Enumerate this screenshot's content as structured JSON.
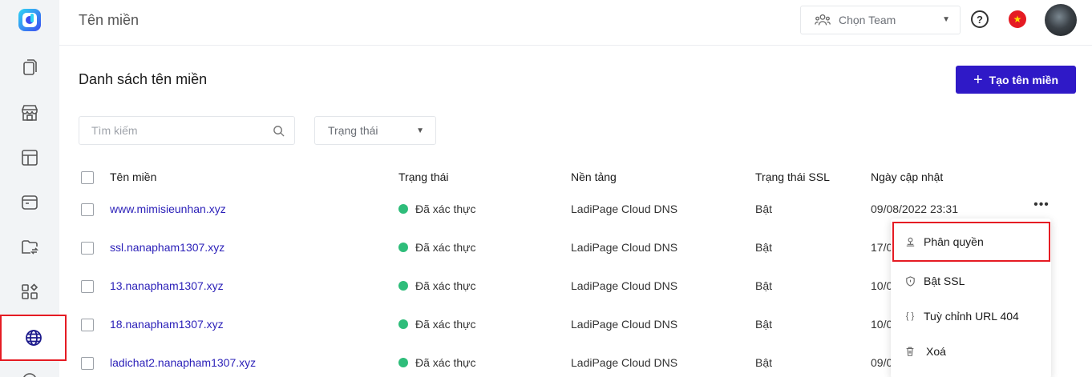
{
  "header": {
    "title": "Tên miền",
    "team_select": "Chọn Team"
  },
  "main": {
    "list_title": "Danh sách tên miền",
    "create_button": "Tạo tên miền",
    "search_placeholder": "Tìm kiếm",
    "status_filter": "Trạng thái"
  },
  "table": {
    "headers": [
      "Tên miền",
      "Trạng thái",
      "Nền tảng",
      "Trạng thái SSL",
      "Ngày cập nhật"
    ],
    "rows": [
      {
        "domain": "www.mimisieunhan.xyz",
        "status": "Đã xác thực",
        "platform": "LadiPage Cloud DNS",
        "ssl": "Bật",
        "updated": "09/08/2022 23:31"
      },
      {
        "domain": "ssl.nanapham1307.xyz",
        "status": "Đã xác thực",
        "platform": "LadiPage Cloud DNS",
        "ssl": "Bật",
        "updated": "17/0"
      },
      {
        "domain": "13.nanapham1307.xyz",
        "status": "Đã xác thực",
        "platform": "LadiPage Cloud DNS",
        "ssl": "Bật",
        "updated": "10/0"
      },
      {
        "domain": "18.nanapham1307.xyz",
        "status": "Đã xác thực",
        "platform": "LadiPage Cloud DNS",
        "ssl": "Bật",
        "updated": "10/0"
      },
      {
        "domain": "ladichat2.nanapham1307.xyz",
        "status": "Đã xác thực",
        "platform": "LadiPage Cloud DNS",
        "ssl": "Bật",
        "updated": "09/0"
      }
    ]
  },
  "menu": {
    "items": [
      "Phân quyền",
      "Bật SSL",
      "Tuỳ chỉnh URL 404",
      "Xoá"
    ],
    "curly_glyph": "{ }"
  },
  "colors": {
    "primary": "#2f19c7",
    "link": "#2a1fb8",
    "verified_dot": "#2ebd7a",
    "highlight_border": "#e51b23"
  }
}
